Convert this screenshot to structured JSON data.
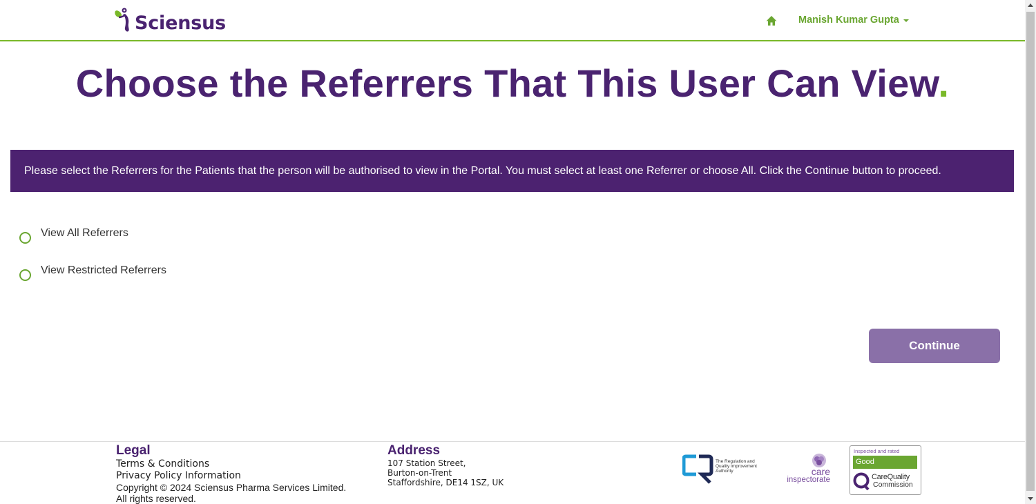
{
  "header": {
    "logo_text": "Sciensus",
    "user_name": "Manish Kumar Gupta"
  },
  "main": {
    "title": "Choose the Referrers That This User Can View",
    "title_dot": ".",
    "instructions": "Please select the Referrers for the Patients that the person will be authorised to view in the Portal. You must select at least one Referrer or choose All. Click the Continue button to proceed.",
    "options": [
      {
        "label": "View All Referrers",
        "selected": false
      },
      {
        "label": "View Restricted Referrers",
        "selected": false
      }
    ],
    "continue_label": "Continue"
  },
  "footer": {
    "legal_heading": "Legal",
    "terms": "Terms & Conditions",
    "privacy": "Privacy Policy Information",
    "copyright": "Copyright © 2024 Sciensus Pharma Services Limited.",
    "rights": "All rights reserved.",
    "address_heading": "Address",
    "address_lines": [
      "107 Station Street,",
      "Burton-on-Trent",
      "Staffordshire, DE14 1SZ, UK"
    ],
    "rqia_text": "The Regulation and Quality Improvement Authority",
    "care_word": "care",
    "inspectorate_word": "inspectorate",
    "cqc_top": "Inspected and rated",
    "cqc_rating": "Good",
    "cqc_name_1": "CareQuality",
    "cqc_name_2": "Commission"
  },
  "colors": {
    "brand_purple": "#4a2370",
    "brand_green": "#7ab929",
    "banner_purple": "#4c2270",
    "button_purple": "#8a70a8"
  },
  "icons": {
    "home": "home-icon",
    "caret": "caret-down-icon",
    "radio": "radio-unchecked-icon"
  }
}
